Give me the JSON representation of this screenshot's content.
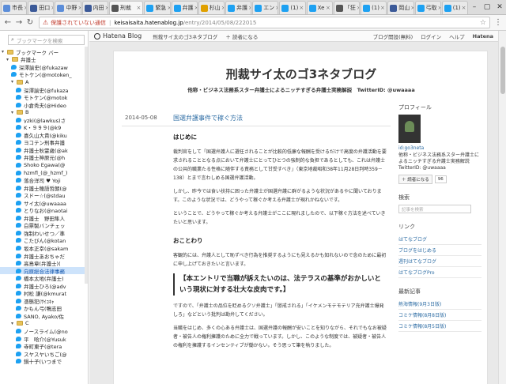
{
  "tabs": [
    {
      "label": "市長",
      "color": "#5b8dd9"
    },
    {
      "label": "田口",
      "color": "#3b5998"
    },
    {
      "label": "中野",
      "color": "#5b8dd9"
    },
    {
      "label": "内田",
      "color": "#3b5998"
    },
    {
      "label": "刑裁",
      "color": "#555555",
      "active": true
    },
    {
      "label": "緊急",
      "color": "#1da1f2"
    },
    {
      "label": "弁護",
      "color": "#1da1f2"
    },
    {
      "label": "杉山",
      "color": "#e0a000"
    },
    {
      "label": "弁護",
      "color": "#1da1f2"
    },
    {
      "label": "エン",
      "color": "#1da1f2"
    },
    {
      "label": "(1)",
      "color": "#1da1f2"
    },
    {
      "label": "Xe",
      "color": "#1da1f2"
    },
    {
      "label": "「狂",
      "color": "#555555"
    },
    {
      "label": "(1)",
      "color": "#1da1f2"
    },
    {
      "label": "岡山",
      "color": "#3b5998"
    },
    {
      "label": "弓取",
      "color": "#1da1f2"
    },
    {
      "label": "(1)",
      "color": "#1da1f2"
    }
  ],
  "address": {
    "insecure_label": "保護されていない通信",
    "host": "keisaisaita.hatenablog.jp",
    "path": "/entry/2014/05/08/222015"
  },
  "sidebar": {
    "search_placeholder": "ブックマークを検索",
    "items": [
      {
        "label": "ブックマーク バー",
        "kind": "folder",
        "indent": 0,
        "open": true
      },
      {
        "label": "弁護士",
        "kind": "folder",
        "indent": 1,
        "open": true
      },
      {
        "label": "深澤諭史(@fukazaw",
        "kind": "tw",
        "indent": 2
      },
      {
        "label": "モトケン(@motoken_",
        "kind": "tw",
        "indent": 2
      },
      {
        "label": "A",
        "kind": "folder",
        "indent": 2,
        "open": true
      },
      {
        "label": "深澤諭史(@fukaza",
        "kind": "tw",
        "indent": 3
      },
      {
        "label": "モトケン(@motok",
        "kind": "tw",
        "indent": 3
      },
      {
        "label": "小倉秀夫(@Hideo",
        "kind": "tw",
        "indent": 3
      },
      {
        "label": "B",
        "kind": "folder",
        "indent": 2,
        "open": true
      },
      {
        "label": "yzki(@lawkus)さ",
        "kind": "tw",
        "indent": 3
      },
      {
        "label": "K・９９９(@k9",
        "kind": "tw",
        "indent": 3
      },
      {
        "label": "喜久山大貴(@kiku",
        "kind": "tw",
        "indent": 3
      },
      {
        "label": "ヨコテン刑事弁護",
        "kind": "tw",
        "indent": 3
      },
      {
        "label": "弁護士秋霊歳(@ak",
        "kind": "tw",
        "indent": 3
      },
      {
        "label": "弁護士神原元(@h",
        "kind": "tw",
        "indent": 3
      },
      {
        "label": "Shoko Egawa(@",
        "kind": "tw",
        "indent": 3
      },
      {
        "label": "hzmfl_(@_hzmf_)",
        "kind": "tw",
        "indent": 3
      },
      {
        "label": "落合洋司 ♥ Yoji",
        "kind": "tw",
        "indent": 3
      },
      {
        "label": "弁護士穂語哲朗(@",
        "kind": "tw",
        "indent": 3
      },
      {
        "label": "スドー☆(@stdau",
        "kind": "tw",
        "indent": 3
      },
      {
        "label": "サイ太(@uwaaaa",
        "kind": "tw",
        "indent": 3
      },
      {
        "label": "とりなお(@naotai",
        "kind": "tw",
        "indent": 3
      },
      {
        "label": "弁護士　野田隼人",
        "kind": "tw",
        "indent": 3
      },
      {
        "label": "白票製バンチェッ",
        "kind": "tw",
        "indent": 3
      },
      {
        "label": "強制わいせつ／準",
        "kind": "tw",
        "indent": 3
      },
      {
        "label": "こたびん(@kotan",
        "kind": "tw",
        "indent": 3
      },
      {
        "label": "坂本正幸(@sakam",
        "kind": "tw",
        "indent": 3
      },
      {
        "label": "弁護士あおちゃだ",
        "kind": "tw",
        "indent": 3
      },
      {
        "label": "高島章(弁護士)(",
        "kind": "tw",
        "indent": 3
      },
      {
        "label": "向原総合法律事務",
        "kind": "tw",
        "indent": 3,
        "selected": true
      },
      {
        "label": "橋本太地(弁護士)",
        "kind": "tw",
        "indent": 3
      },
      {
        "label": "弁護士ひろ(@adv",
        "kind": "tw",
        "indent": 3
      },
      {
        "label": "村松 謙(@kmurat",
        "kind": "tw",
        "indent": 3
      },
      {
        "label": "憑態犯(ｻｲｺｷｬ",
        "kind": "tw",
        "indent": 3
      },
      {
        "label": "かもん弓(鴨志田",
        "kind": "tw",
        "indent": 3
      },
      {
        "label": "SANO, Ayako/佐",
        "kind": "tw",
        "indent": 3
      },
      {
        "label": "C",
        "kind": "folder",
        "indent": 2,
        "open": true
      },
      {
        "label": "ノースライム(@no",
        "kind": "tw",
        "indent": 3
      },
      {
        "label": "平　哈介(@Yusuk",
        "kind": "tw",
        "indent": 3
      },
      {
        "label": "寺町東子(@tera",
        "kind": "tw",
        "indent": 3
      },
      {
        "label": "スヤスヤいちご(@",
        "kind": "tw",
        "indent": 3
      },
      {
        "label": "鍋十子(いつまで",
        "kind": "tw",
        "indent": 3
      }
    ]
  },
  "hatena_bar": {
    "logo": "Hatena Blog",
    "blog_name": "刑裁サイ太のゴ3ネタブログ",
    "readers": "＋ 読者になる",
    "open_blog": "ブログ開設(無料)",
    "login": "ログイン",
    "help": "ヘルプ",
    "hatena": "Hatena"
  },
  "blog": {
    "title": "刑裁サイ太のゴ3ネタブログ",
    "description": "他称・ビジネス法務系スター弁護士によるニッチすぎる弁護士実務解説　TwitterID: @uwaaaa"
  },
  "post": {
    "date": "2014-05-08",
    "title": "国選弁護事件で稼ぐ方法",
    "h1": "はじめに",
    "p1": "裁判官をして「国選弁護人に選任されることが比較的低廉な報酬を受けるだけで高度の弁護活動を要求されることとなる点において弁護士にとってひとつの強制的な負担であるとしても、これは弁護士の公共的職業たる性格に随伴する責務として甘受すべき」（東京地裁昭和38年11月28日判時359－138）とまで言わしめる国選弁護活動。",
    "p2": "しかし、昨今では食い扶持に困った弁護士が国選弁護に群がるような状況があるやに聞いております。このような状況では、どうやって稼ぐか考える弁護士が現れかねないです。",
    "p3": "ということで、どうやって稼ぐか考える弁護士がここに現れましたので、以下稼ぐ方法を述べていきたいと思います。",
    "h2": "おことわり",
    "p4": "客観的には、弁護人として恥ずべき行為を推奨するようにも見えるかも知れないので念のために最初に申し上げておきたいと言います。",
    "quote": "【本エントリで当職が訴えたいのは、法テラスの基準がおかしいという現状に対する壮大な皮肉です。】",
    "p5": "ですので、「弁護士の品位を貶めるクソ弁護士」「懲戒される」「イケメンモテモテリア充弁護士爆発しろ」などという批判は勘弁してください。",
    "p6": "当職をはじめ、多くの心ある弁護士は、国選弁護の報酬が安いことを知りながら、それでもなお被疑者・被告人の権利擁護のために全力で戦っています。しかし、このような制度では、被疑者・被告人の権利を擁護するインセンティブが働かない。そう思って筆を執りました。"
  },
  "side": {
    "profile_heading": "プロフィール",
    "user_id": "id:go3neta",
    "profile_desc": "他称・ビジネス法務系スター弁護士によるニッチすぎる弁護士実務解説　TwitterID: @uwaaaa",
    "readers_btn": "＋ 読者になる",
    "readers_count": "96",
    "search_heading": "検索",
    "search_placeholder": "記事を検索",
    "links_heading": "リンク",
    "links": [
      "はてなブログ",
      "ブログをはじめる",
      "週刊はてなブログ",
      "はてなブログPro"
    ],
    "recent_heading": "最新記事",
    "recent": [
      "熱海情報(9月3日版)",
      "コミケ情報(8月8日版)",
      "コミケ情報(8月5日版)"
    ]
  }
}
